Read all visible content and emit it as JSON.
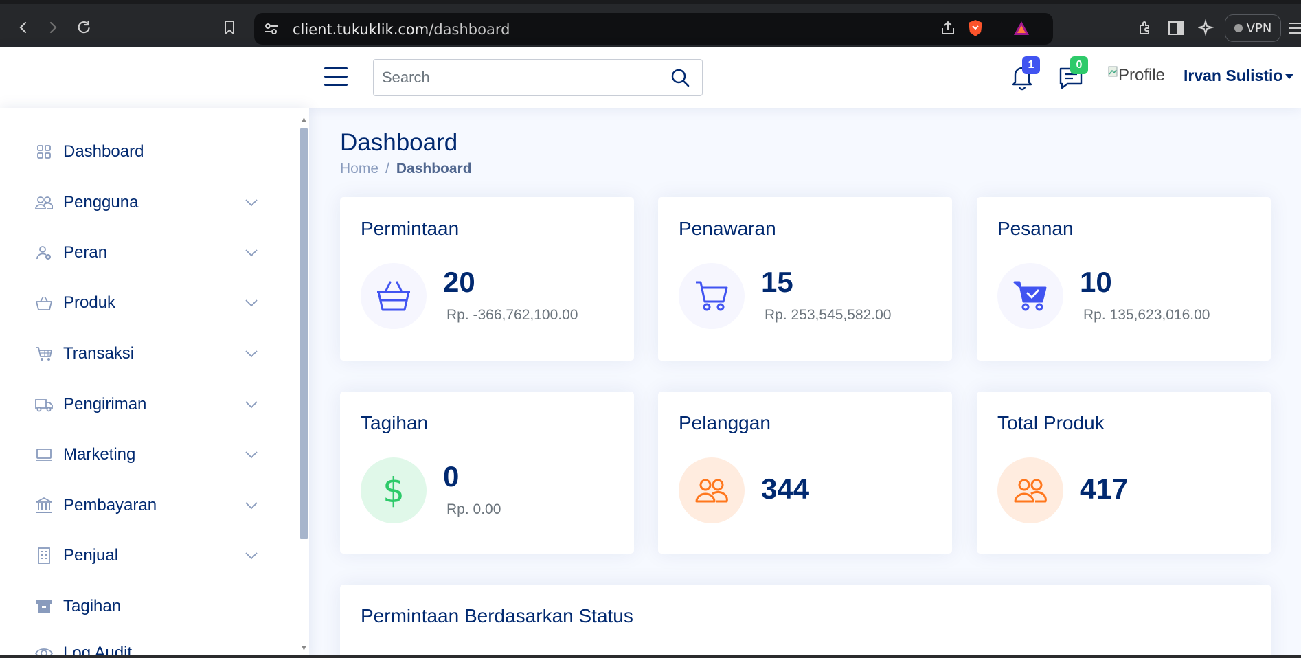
{
  "browser": {
    "url_host": "client.tukuklik.com",
    "url_path": "/dashboard",
    "vpn_label": "VPN"
  },
  "header": {
    "search_placeholder": "Search",
    "notifications_count": "1",
    "messages_count": "0",
    "profile_image_alt": "Profile",
    "user_name": "Irvan Sulistio"
  },
  "sidebar": {
    "items": [
      {
        "label": "Dashboard",
        "icon": "grid-icon",
        "has_chevron": false
      },
      {
        "label": "Pengguna",
        "icon": "people-icon",
        "has_chevron": true
      },
      {
        "label": "Peran",
        "icon": "person-role-icon",
        "has_chevron": true
      },
      {
        "label": "Produk",
        "icon": "basket-icon",
        "has_chevron": true
      },
      {
        "label": "Transaksi",
        "icon": "cart-icon",
        "has_chevron": true
      },
      {
        "label": "Pengiriman",
        "icon": "truck-icon",
        "has_chevron": true
      },
      {
        "label": "Marketing",
        "icon": "laptop-icon",
        "has_chevron": true
      },
      {
        "label": "Pembayaran",
        "icon": "bank-icon",
        "has_chevron": true
      },
      {
        "label": "Penjual",
        "icon": "building-icon",
        "has_chevron": true
      },
      {
        "label": "Tagihan",
        "icon": "archive-icon",
        "has_chevron": false
      },
      {
        "label": "Log Audit",
        "icon": "eye-icon",
        "has_chevron": false
      }
    ]
  },
  "page": {
    "title": "Dashboard",
    "breadcrumb_home": "Home",
    "breadcrumb_separator": "/",
    "breadcrumb_current": "Dashboard"
  },
  "cards": [
    {
      "title": "Permintaan",
      "value": "20",
      "sub": "Rp. -366,762,100.00",
      "icon": "basket-icon",
      "tone": "blue"
    },
    {
      "title": "Penawaran",
      "value": "15",
      "sub": "Rp. 253,545,582.00",
      "icon": "cart-icon",
      "tone": "blue"
    },
    {
      "title": "Pesanan",
      "value": "10",
      "sub": "Rp. 135,623,016.00",
      "icon": "cart-check-icon",
      "tone": "blue"
    },
    {
      "title": "Tagihan",
      "value": "0",
      "sub": "Rp. 0.00",
      "icon": "dollar-icon",
      "tone": "green"
    },
    {
      "title": "Pelanggan",
      "value": "344",
      "sub": "",
      "icon": "people-icon",
      "tone": "orange"
    },
    {
      "title": "Total Produk",
      "value": "417",
      "sub": "",
      "icon": "people-icon",
      "tone": "orange"
    }
  ],
  "section": {
    "title": "Permintaan Berdasarkan Status"
  },
  "colors": {
    "primary": "#012970",
    "accent_blue": "#4154f1",
    "green": "#2eca6a",
    "orange": "#ff771d",
    "bg": "#f6f9ff"
  }
}
